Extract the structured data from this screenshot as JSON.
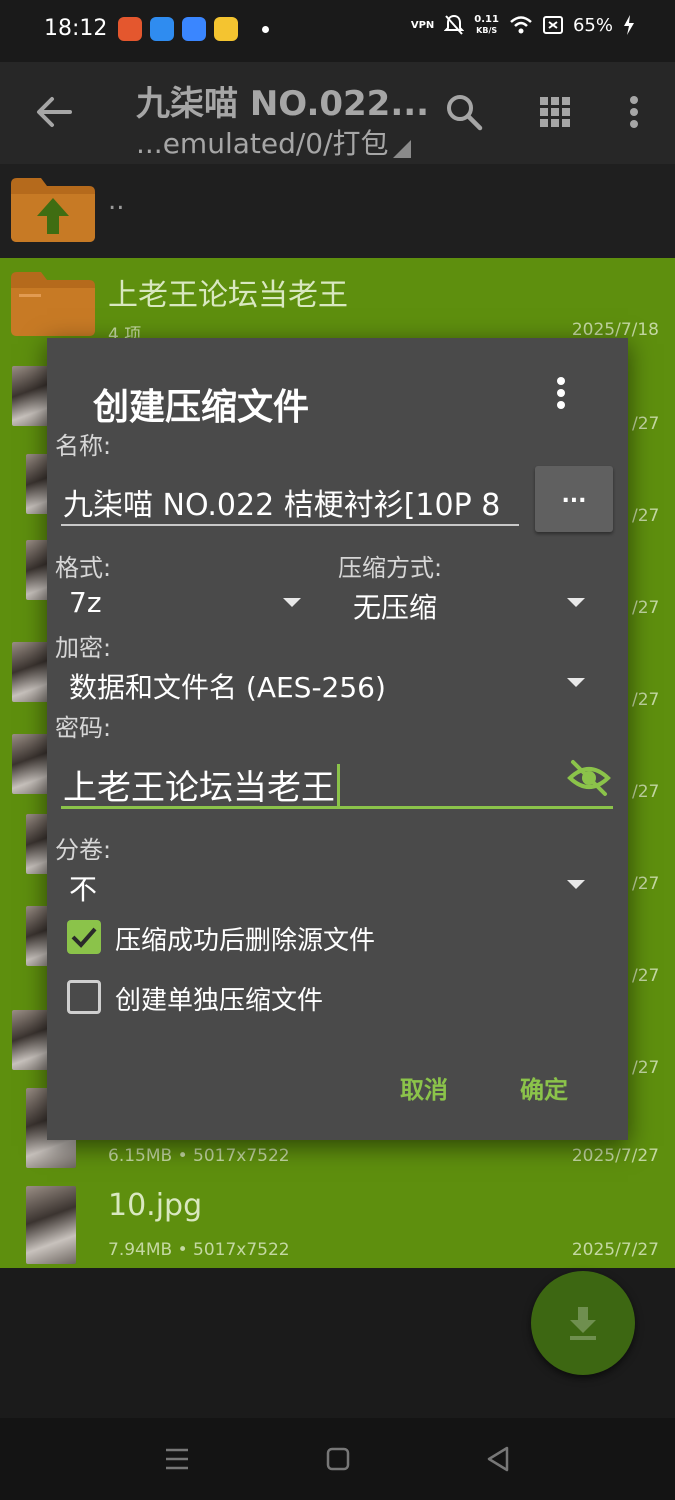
{
  "status_bar": {
    "time": "18:12",
    "vpn": "VPN",
    "net_speed_value": "0.11",
    "net_speed_unit": "KB/S",
    "battery": "65%"
  },
  "toolbar": {
    "title": "九柒喵 NO.022...",
    "path": "...emulated/0/打包"
  },
  "file_list": {
    "parent_label": "..",
    "folder": {
      "name": "上老王论坛当老王",
      "count": "4 项",
      "date": "2025/7/18"
    },
    "partial_dates": [
      "/27",
      "/27",
      "/27",
      "/27",
      "/27",
      "/27",
      "/27",
      "/27"
    ],
    "row_9": {
      "meta": "6.15MB",
      "resolution": "5017x7522",
      "sep": "•",
      "date": "2025/7/27"
    },
    "row_10": {
      "name": "10.jpg",
      "meta": "7.94MB",
      "resolution": "5017x7522",
      "sep": "•",
      "date": "2025/7/27"
    }
  },
  "dialog": {
    "title": "创建压缩文件",
    "name_label": "名称:",
    "name_value": "九柒喵 NO.022 桔梗衬衫[10P 8",
    "browse_label": "...",
    "format_label": "格式:",
    "format_value": "7z",
    "compression_label": "压缩方式:",
    "compression_value": "无压缩",
    "encryption_label": "加密:",
    "encryption_value": "数据和文件名 (AES-256)",
    "password_label": "密码:",
    "password_value": "上老王论坛当老王",
    "split_label": "分卷:",
    "split_value": "不",
    "delete_source_label": "压缩成功后删除源文件",
    "delete_source_checked": true,
    "separate_archives_label": "创建单独压缩文件",
    "separate_archives_checked": false,
    "cancel_label": "取消",
    "ok_label": "确定"
  },
  "colors": {
    "accent": "#8bc34a",
    "selection": "#5e8f0e",
    "fab": "#3d6712",
    "dialog": "#4a4a4a"
  }
}
